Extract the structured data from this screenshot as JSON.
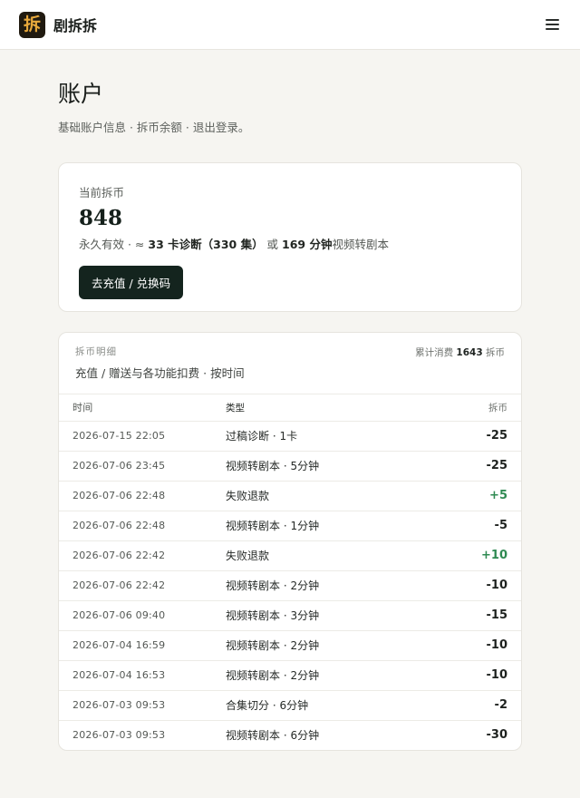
{
  "app": {
    "name": "剧拆拆",
    "logo_glyph": "拆"
  },
  "page": {
    "title": "账户",
    "subtitle": "基础账户信息 · 拆币余额 · 退出登录。"
  },
  "balance": {
    "label": "当前拆币",
    "value": "848",
    "desc_prefix": "永久有效 · ≈ ",
    "desc_cards": "33 卡诊断（330 集）",
    "desc_mid": " 或 ",
    "desc_minutes": "169 分钟",
    "desc_suffix": "视频转剧本",
    "recharge_label": "去充值 / 兑换码"
  },
  "ledger": {
    "kicker": "拆币明细",
    "title": "充值 / 赠送与各功能扣费 · 按时间",
    "total_prefix": "累计消费 ",
    "total_value": "1643",
    "total_suffix": " 拆币",
    "columns": {
      "time": "时间",
      "type": "类型",
      "amount": "拆币"
    },
    "rows": [
      {
        "time": "2026-07-15 22:05",
        "type": "过稿诊断 · 1卡",
        "amount": "-25",
        "positive": false
      },
      {
        "time": "2026-07-06 23:45",
        "type": "视频转剧本 · 5分钟",
        "amount": "-25",
        "positive": false
      },
      {
        "time": "2026-07-06 22:48",
        "type": "失败退款",
        "amount": "+5",
        "positive": true
      },
      {
        "time": "2026-07-06 22:48",
        "type": "视频转剧本 · 1分钟",
        "amount": "-5",
        "positive": false
      },
      {
        "time": "2026-07-06 22:42",
        "type": "失败退款",
        "amount": "+10",
        "positive": true
      },
      {
        "time": "2026-07-06 22:42",
        "type": "视频转剧本 · 2分钟",
        "amount": "-10",
        "positive": false
      },
      {
        "time": "2026-07-06 09:40",
        "type": "视频转剧本 · 3分钟",
        "amount": "-15",
        "positive": false
      },
      {
        "time": "2026-07-04 16:59",
        "type": "视频转剧本 · 2分钟",
        "amount": "-10",
        "positive": false
      },
      {
        "time": "2026-07-04 16:53",
        "type": "视频转剧本 · 2分钟",
        "amount": "-10",
        "positive": false
      },
      {
        "time": "2026-07-03 09:53",
        "type": "合集切分 · 6分钟",
        "amount": "-2",
        "positive": false
      },
      {
        "time": "2026-07-03 09:53",
        "type": "视频转剧本 · 6分钟",
        "amount": "-30",
        "positive": false
      }
    ]
  },
  "colors": {
    "positive": "#2f8a52",
    "button": "#14241e",
    "logo_bg": "#201a10",
    "logo_fg": "#e8a93c"
  },
  "icons": {
    "menu": "hamburger-menu-icon",
    "logo": "app-logo-icon"
  }
}
